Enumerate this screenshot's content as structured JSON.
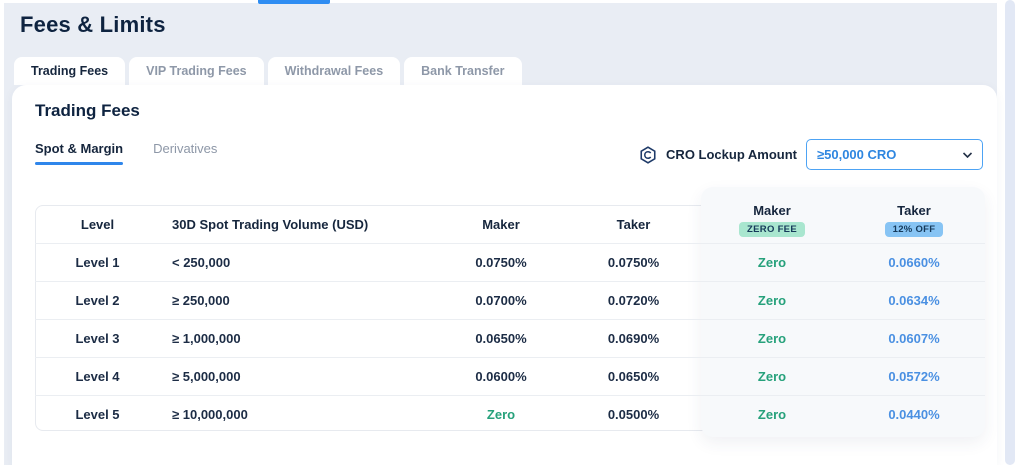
{
  "page": {
    "title": "Fees & Limits"
  },
  "tabs": [
    {
      "label": "Trading Fees",
      "active": true
    },
    {
      "label": "VIP Trading Fees",
      "active": false
    },
    {
      "label": "Withdrawal Fees",
      "active": false
    },
    {
      "label": "Bank Transfer",
      "active": false
    }
  ],
  "card": {
    "heading": "Trading Fees"
  },
  "subtabs": [
    {
      "label": "Spot & Margin",
      "active": true
    },
    {
      "label": "Derivatives",
      "active": false
    }
  ],
  "lockup": {
    "icon": "cro-hexagon-icon",
    "label": "CRO Lockup Amount",
    "value": "≥50,000 CRO"
  },
  "table": {
    "headers": {
      "level": "Level",
      "volume": "30D Spot Trading Volume (USD)",
      "maker": "Maker",
      "taker": "Taker"
    },
    "panel": {
      "maker_label": "Maker",
      "maker_badge": "ZERO FEE",
      "taker_label": "Taker",
      "taker_badge": "12% OFF"
    },
    "rows": [
      {
        "level": "Level 1",
        "volume": "< 250,000",
        "maker": "0.0750%",
        "taker": "0.0750%",
        "lockup_maker": "Zero",
        "lockup_taker": "0.0660%"
      },
      {
        "level": "Level 2",
        "volume": "≥ 250,000",
        "maker": "0.0700%",
        "taker": "0.0720%",
        "lockup_maker": "Zero",
        "lockup_taker": "0.0634%"
      },
      {
        "level": "Level 3",
        "volume": "≥ 1,000,000",
        "maker": "0.0650%",
        "taker": "0.0690%",
        "lockup_maker": "Zero",
        "lockup_taker": "0.0607%"
      },
      {
        "level": "Level 4",
        "volume": "≥ 5,000,000",
        "maker": "0.0600%",
        "taker": "0.0650%",
        "lockup_maker": "Zero",
        "lockup_taker": "0.0572%"
      },
      {
        "level": "Level 5",
        "volume": "≥ 10,000,000",
        "maker": "Zero",
        "taker": "0.0500%",
        "lockup_maker": "Zero",
        "lockup_taker": "0.0440%"
      }
    ]
  },
  "colors": {
    "accent_blue": "#2f86eb",
    "zero_green": "#26a17b",
    "value_blue": "#4a90e2",
    "badge_mint": "#a9e6cf",
    "badge_sky": "#87c4f4",
    "page_bg": "#e9edf4",
    "panel_bg": "#f7f9fb"
  }
}
